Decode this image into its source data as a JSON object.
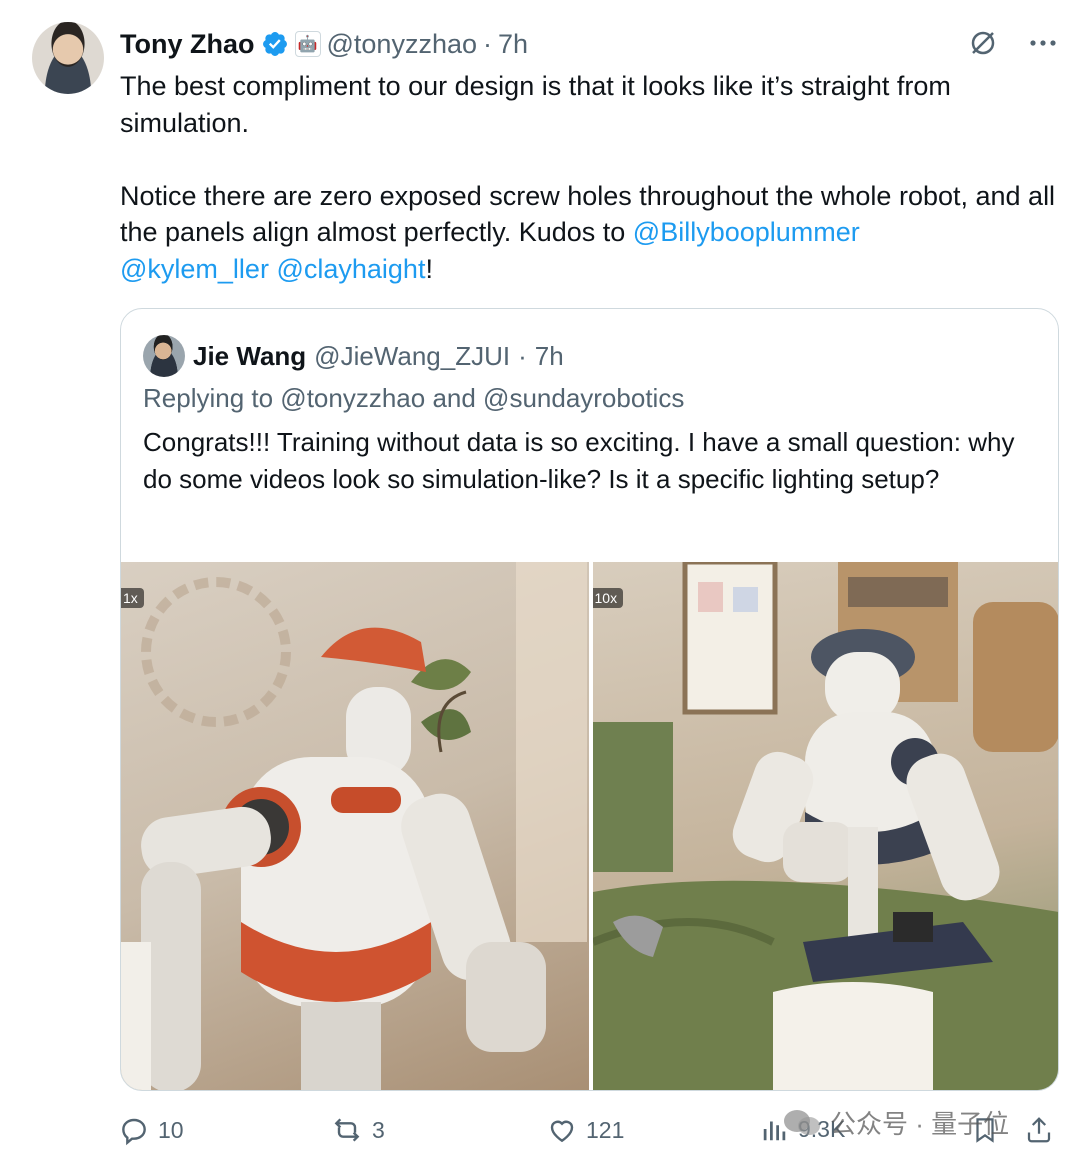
{
  "author": {
    "name": "Tony Zhao",
    "handle": "@tonyzzhao",
    "separator": "·",
    "time": "7h",
    "affiliation_glyph": "🤖"
  },
  "tweet": {
    "text_before": "The best compliment to our design is that it looks like it’s straight from simulation.\n\nNotice there are zero exposed screw holes throughout the whole robot, and all the panels align almost perfectly. Kudos to ",
    "mentions": [
      "@Billybooplummer",
      "@kylem_ller",
      "@clayhaight"
    ],
    "text_after": "!"
  },
  "quote": {
    "name": "Jie Wang",
    "handle": "@JieWang_ZJUI",
    "separator": "·",
    "time": "7h",
    "replying_to": "Replying to @tonyzzhao and @sundayrobotics",
    "text": "Congrats!!! Training without data is so exciting. I have a small question: why do some videos look so simulation-like? Is it a specific lighting setup?",
    "media": [
      {
        "badge": "1x",
        "description": "robot-orange"
      },
      {
        "badge": "10x",
        "description": "robot-blue-cap"
      }
    ]
  },
  "actions": {
    "replies": "10",
    "reposts": "3",
    "likes": "121",
    "views": "9.3K"
  },
  "watermark": {
    "text": "公众号 · 量子位"
  },
  "colors": {
    "accent": "#1d9bf0",
    "secondary_text": "#536471",
    "border": "#cfd9de"
  }
}
